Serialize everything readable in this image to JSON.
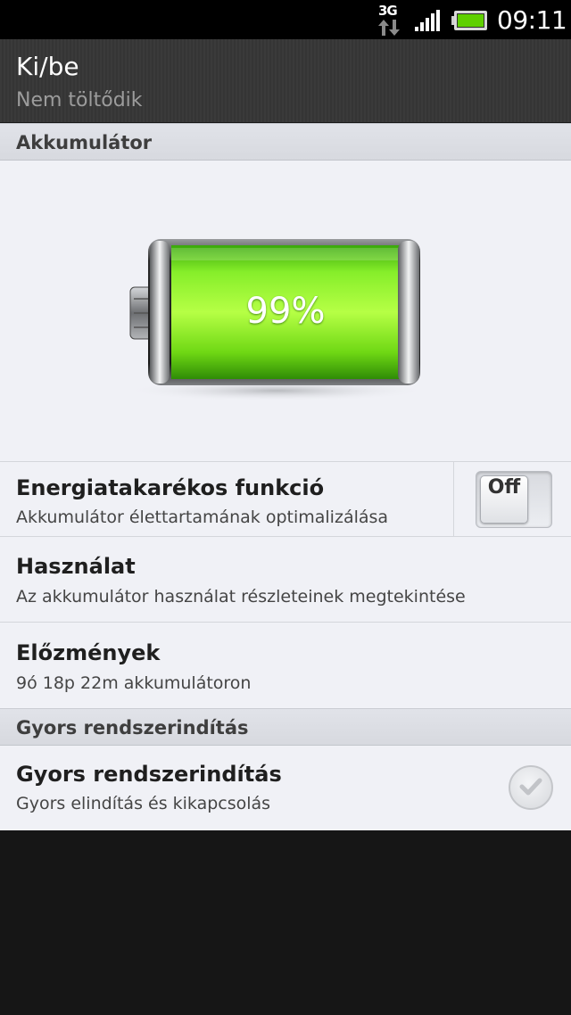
{
  "status_bar": {
    "network": "3G",
    "time": "09:11"
  },
  "header": {
    "title": "Ki/be",
    "subtitle": "Nem töltődik"
  },
  "sections": {
    "battery": "Akkumulátor",
    "fast_boot": "Gyors rendszerindítás"
  },
  "battery": {
    "percent_label": "99%",
    "level": 0.99,
    "color": "#6fd814"
  },
  "rows": {
    "power_saver": {
      "title": "Energiatakarékos funkció",
      "subtitle": "Akkumulátor élettartamának optimalizálása",
      "toggle_label": "Off"
    },
    "usage": {
      "title": "Használat",
      "subtitle": "Az akkumulátor használat részleteinek megtekintése"
    },
    "history": {
      "title": "Előzmények",
      "subtitle": "9ó 18p 22m akkumulátoron"
    },
    "fast_boot": {
      "title": "Gyors rendszerindítás",
      "subtitle": "Gyors elindítás és kikapcsolás",
      "checked": false
    }
  },
  "icons": {
    "network_arrows": "updown-arrows-icon",
    "signal": "signal-bars-icon",
    "battery": "battery-icon",
    "checkbox": "checkmark-icon"
  }
}
